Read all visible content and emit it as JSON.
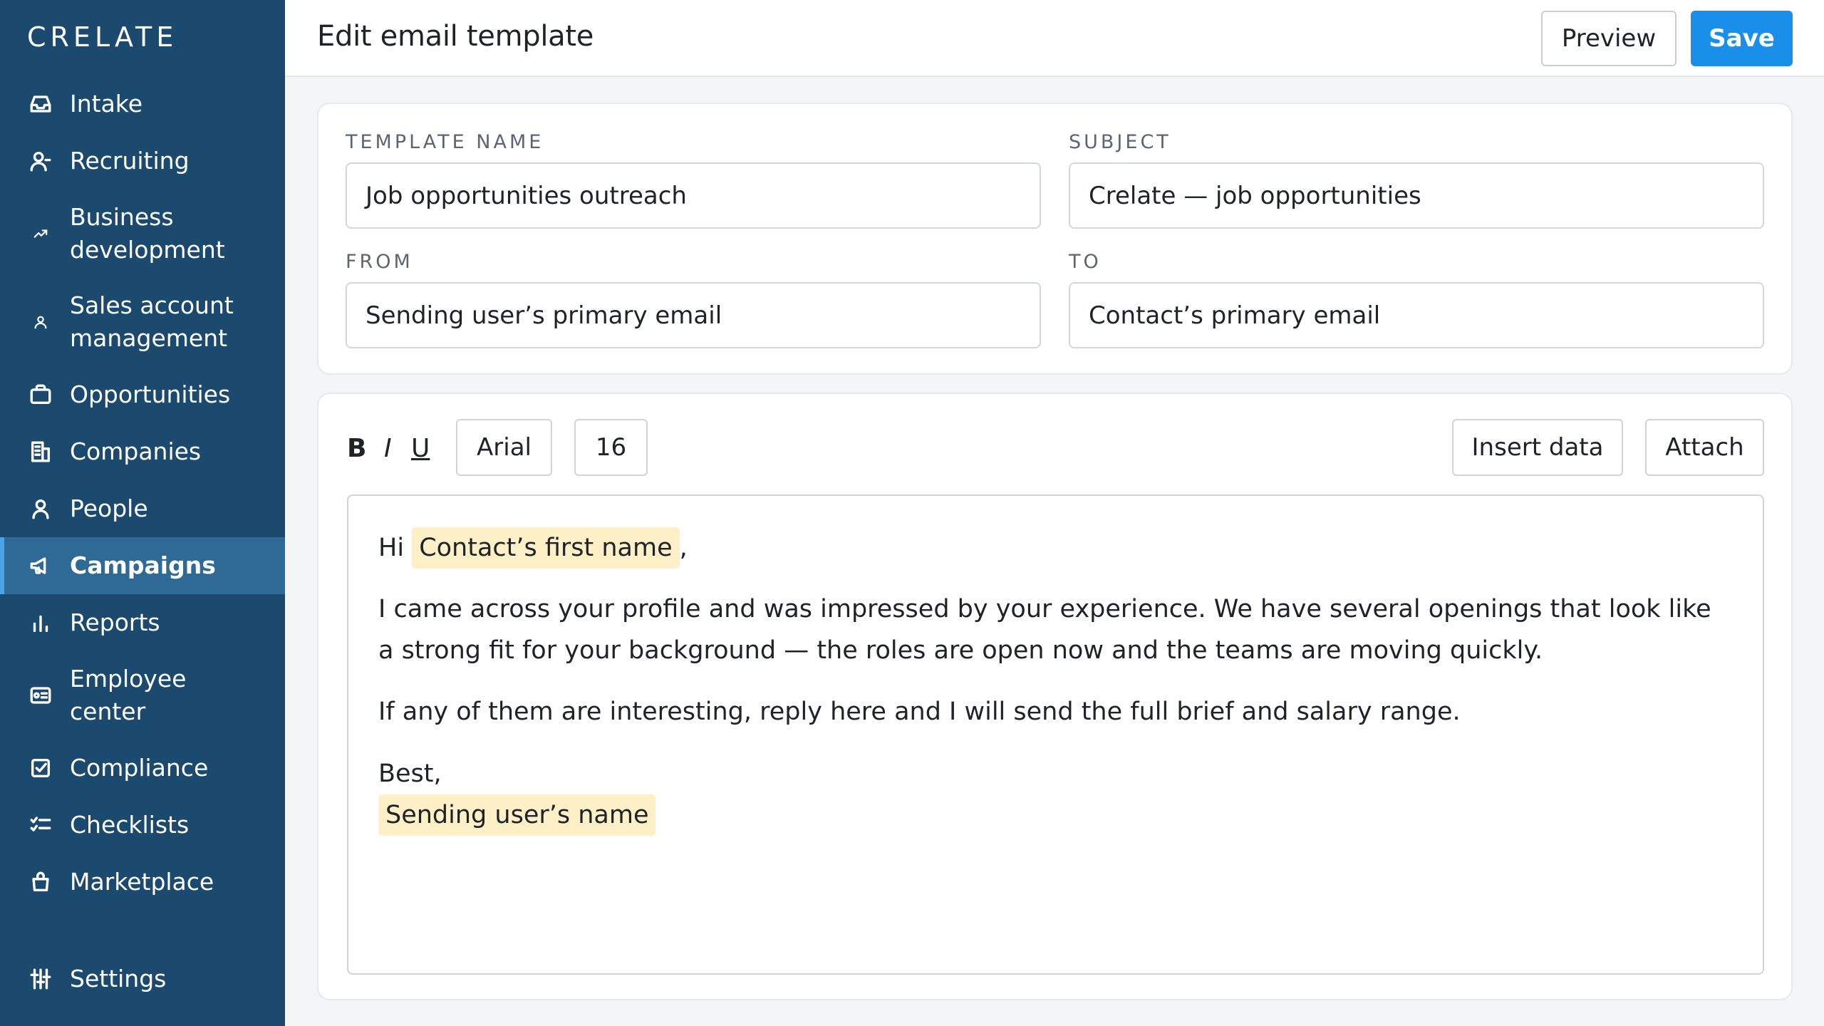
{
  "sidebar": {
    "logo": "CRELATE",
    "items": [
      {
        "label": "Intake",
        "icon": "inbox-icon"
      },
      {
        "label": "Recruiting",
        "icon": "user-icon"
      },
      {
        "label": "Business development",
        "icon": "trend-up-icon"
      },
      {
        "label": "Sales account management",
        "icon": "person-icon"
      },
      {
        "label": "Opportunities",
        "icon": "briefcase-icon"
      },
      {
        "label": "Companies",
        "icon": "building-icon"
      },
      {
        "label": "People",
        "icon": "person-icon"
      },
      {
        "label": "Campaigns",
        "icon": "megaphone-icon",
        "active": true
      },
      {
        "label": "Reports",
        "icon": "bar-chart-icon"
      },
      {
        "label": "Employee center",
        "icon": "id-card-icon"
      },
      {
        "label": "Compliance",
        "icon": "checkbox-icon"
      },
      {
        "label": "Checklists",
        "icon": "checklist-icon"
      },
      {
        "label": "Marketplace",
        "icon": "shopping-bag-icon"
      }
    ],
    "settings": {
      "label": "Settings",
      "icon": "sliders-icon"
    }
  },
  "header": {
    "title": "Edit email template",
    "preview_label": "Preview",
    "save_label": "Save"
  },
  "fields": {
    "template_name": {
      "label": "TEMPLATE NAME",
      "value": "Job opportunities outreach"
    },
    "subject": {
      "label": "SUBJECT",
      "value": "Crelate — job opportunities"
    },
    "from": {
      "label": "FROM",
      "value": "Sending user’s primary email"
    },
    "to": {
      "label": "TO",
      "value": "Contact’s primary email"
    }
  },
  "toolbar": {
    "bold": "B",
    "italic": "I",
    "underline": "U",
    "font": "Arial",
    "size": "16",
    "insert_data": "Insert data",
    "attach": "Attach"
  },
  "email": {
    "greeting": "Hi",
    "greeting_token": "Contact’s first name",
    "greeting_suffix": ",",
    "paragraph1": "I came across your profile and was impressed by your experience. We have several openings that look like a strong fit for your background — the roles are open now and the teams are moving quickly.",
    "paragraph2": "If any of them are interesting, reply here and I will send the full brief and salary range.",
    "signoff": "Best,",
    "sender_token": "Sending user’s name"
  },
  "colors": {
    "sidebar_bg": "#1b4a6e",
    "sidebar_active": "#2f6a97",
    "accent": "#1a8fea",
    "token_highlight": "#fdf0c6"
  }
}
